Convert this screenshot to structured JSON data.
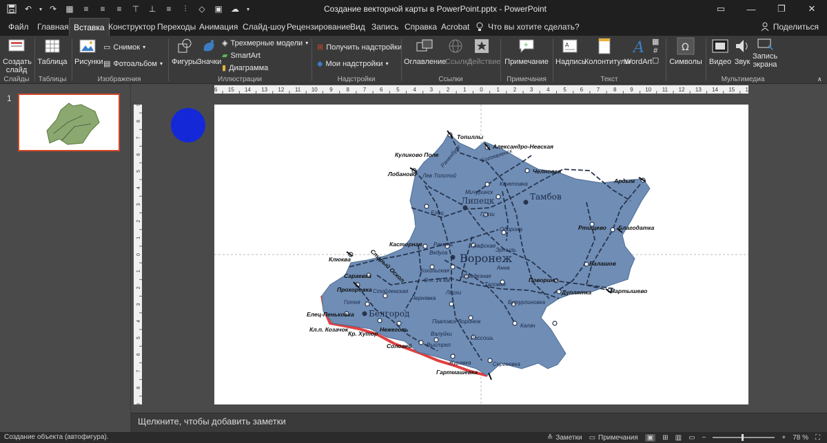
{
  "window": {
    "title": "Создание векторной карты в PowerPoint.pptx  -  PowerPoint",
    "controls": [
      "ribbon-display-icon",
      "minimize-icon",
      "restore-icon",
      "close-icon"
    ]
  },
  "tabs": [
    {
      "label": "Файл",
      "active": false
    },
    {
      "label": "Главная",
      "active": false
    },
    {
      "label": "Вставка",
      "active": true
    },
    {
      "label": "Конструктор",
      "active": false
    },
    {
      "label": "Переходы",
      "active": false
    },
    {
      "label": "Анимация",
      "active": false
    },
    {
      "label": "Слайд-шоу",
      "active": false
    },
    {
      "label": "Рецензирование",
      "active": false
    },
    {
      "label": "Вид",
      "active": false
    },
    {
      "label": "Запись",
      "active": false
    },
    {
      "label": "Справка",
      "active": false
    },
    {
      "label": "Acrobat",
      "active": false
    }
  ],
  "tell_me": "Что вы хотите сделать?",
  "share": "Поделиться",
  "ribbon": {
    "new_slide": "Создать\nслайд",
    "table": "Таблица",
    "pictures": "Рисунки",
    "screenshot": "Снимок",
    "photo_album": "Фотоальбом",
    "shapes": "Фигуры",
    "icons": "Значки",
    "models3d": "Трехмерные модели",
    "smartart": "SmartArt",
    "chart": "Диаграмма",
    "get_addins": "Получить надстройки",
    "my_addins": "Мои надстройки",
    "zoom": "Оглавление",
    "link": "Ссылка",
    "action": "Действие",
    "comment": "Примечание",
    "textbox": "Надпись",
    "header_footer": "Колонтитулы",
    "wordart": "WordArt",
    "symbols": "Символы",
    "video": "Видео",
    "audio": "Звук",
    "screen_recording": "Запись\nэкрана",
    "groups": {
      "slides": "Слайды",
      "tables": "Таблицы",
      "images": "Изображения",
      "illustrations": "Иллюстрации",
      "addins": "Надстройки",
      "links": "Ссылки",
      "comments": "Примечания",
      "text": "Текст",
      "media": "Мультимедиа"
    }
  },
  "slide_pane": {
    "number": "1"
  },
  "ruler": {
    "horizontal": [
      "16",
      "15",
      "14",
      "13",
      "12",
      "11",
      "10",
      "9",
      "8",
      "7",
      "6",
      "5",
      "4",
      "3",
      "2",
      "1",
      "0",
      "1",
      "2",
      "3",
      "4",
      "5",
      "6",
      "7",
      "8",
      "9",
      "10",
      "11",
      "12",
      "13",
      "14",
      "15",
      "16"
    ],
    "vertical": [
      "9",
      "8",
      "7",
      "6",
      "5",
      "4",
      "3",
      "2",
      "1",
      "0",
      "1",
      "2",
      "3",
      "4",
      "5",
      "6",
      "7",
      "8",
      "9"
    ]
  },
  "map": {
    "fill": "#6f8db5",
    "border_red": "#e04040",
    "cities_regular": [
      "Топиллы",
      "Куликово Поле",
      "Александро-Невская",
      "Лобаново",
      "Челновая",
      "Ардым",
      "Касторная",
      "Старый Оскол",
      "Клюква",
      "Сараевка",
      "Прохоровка",
      "Елец-Пеньковка",
      "Кл.п. Козачок",
      "Кр. Хутор",
      "Нежеголь",
      "Соловей",
      "Гартмашевка",
      "Благодатка",
      "Ртищево",
      "Балашов",
      "Мартышево",
      "Поворино",
      "Дуплятка"
    ],
    "cities_italic": [
      "Раненбург",
      "Богоявленск",
      "Лев Толстой",
      "Мичуринск",
      "Кочетовка",
      "Елец",
      "Грязи",
      "Оборона",
      "Рамонь",
      "Графская",
      "Эртиль",
      "Ведуга",
      "Анна",
      "Хохольская",
      "Колодезная",
      "О.п. 14 км",
      "Таловая",
      "Стойленская",
      "Чернявка",
      "Лиски",
      "Бутурлиновка",
      "Готня",
      "Павловск-Воронеж",
      "Калач",
      "Валуйки",
      "Россошь",
      "Выстрел",
      "Журавка",
      "Сергеевка"
    ],
    "cities_big": [
      "Липецк",
      "Тамбов",
      "Воронеж",
      "Белгород"
    ]
  },
  "notes": {
    "placeholder": "Щелкните, чтобы добавить заметки"
  },
  "status": {
    "left": "Создание объекта (автофигура).",
    "notes": "Заметки",
    "comments": "Примечания",
    "zoom": "78 %"
  },
  "colors": {
    "circle": "#1428d8",
    "accent_tab": "#3a3a3a"
  }
}
